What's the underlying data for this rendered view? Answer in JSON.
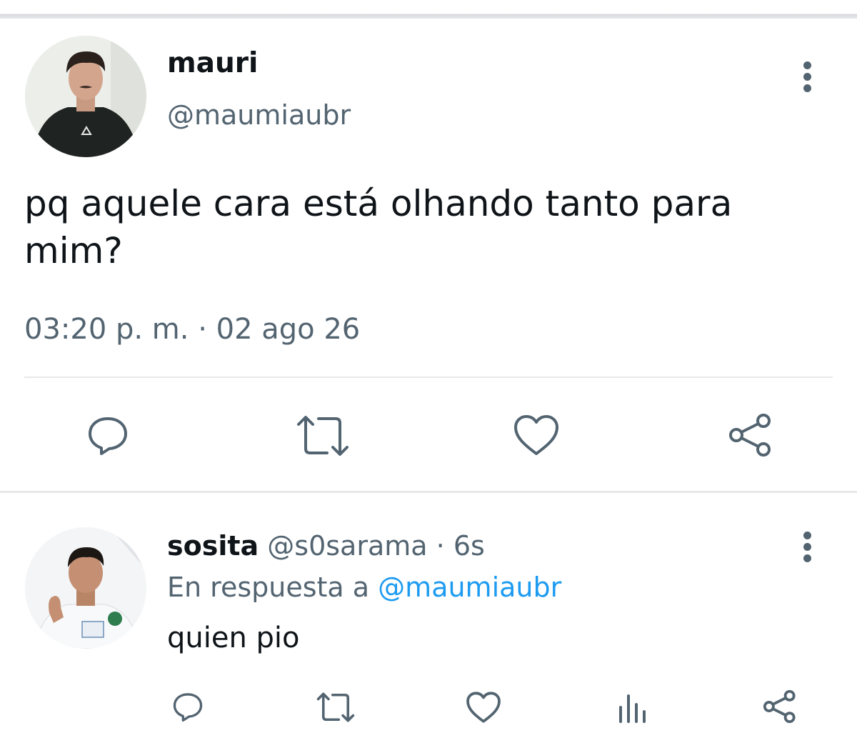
{
  "main_tweet": {
    "author_name": "mauri",
    "author_handle": "@maumiaubr",
    "text": "pq aquele cara está olhando tanto para mim?",
    "timestamp": "03:20 p. m. · 02 ago 26",
    "actions": [
      "reply-icon",
      "retweet-icon",
      "like-icon",
      "share-icon"
    ]
  },
  "reply": {
    "author_name": "sosita",
    "author_handle": "@s0sarama",
    "separator": "·",
    "time": "6s",
    "reply_to_prefix": "En respuesta a",
    "reply_to_handle": "@maumiaubr",
    "text": "quien pio",
    "actions": [
      "reply-icon",
      "retweet-icon",
      "like-icon",
      "analytics-icon",
      "share-icon"
    ]
  },
  "colors": {
    "text_primary": "#0f1419",
    "text_secondary": "#536471",
    "link": "#1d9bf0",
    "divider": "#e6e8ea"
  }
}
